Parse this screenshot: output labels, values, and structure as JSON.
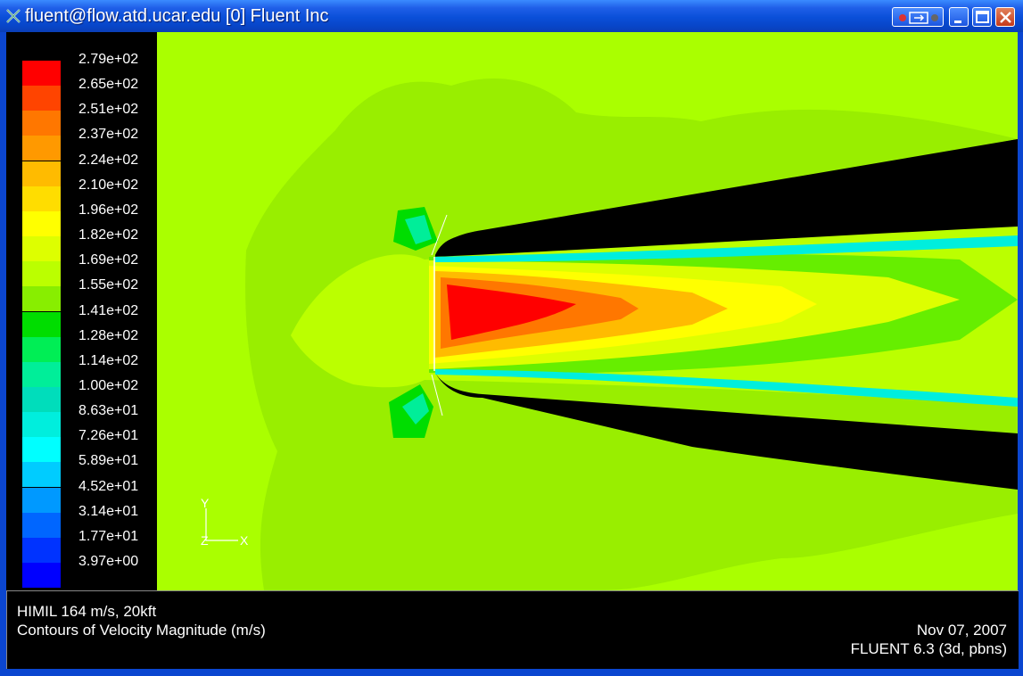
{
  "window": {
    "title": "fluent@flow.atd.ucar.edu [0] Fluent Inc",
    "icon": "x-icon",
    "buttons": [
      "extra-icon",
      "minimize-icon",
      "maximize-icon",
      "close-icon"
    ]
  },
  "legend": {
    "colors": [
      "#ff0000",
      "#ff4400",
      "#ff7700",
      "#ff9900",
      "#ffbb00",
      "#ffdd00",
      "#ffff00",
      "#ddff00",
      "#bbff00",
      "#88ee00",
      "#00dd00",
      "#00ee55",
      "#00ee99",
      "#00ddbb",
      "#00eedd",
      "#00ffff",
      "#00ccff",
      "#0099ff",
      "#0066ff",
      "#0033ff",
      "#0000ff"
    ],
    "labels": [
      "2.79e+02",
      "2.65e+02",
      "2.51e+02",
      "2.37e+02",
      "2.24e+02",
      "2.10e+02",
      "1.96e+02",
      "1.82e+02",
      "1.69e+02",
      "1.55e+02",
      "1.41e+02",
      "1.28e+02",
      "1.14e+02",
      "1.00e+02",
      "8.63e+01",
      "7.26e+01",
      "5.89e+01",
      "4.52e+01",
      "3.14e+01",
      "1.77e+01",
      "3.97e+00"
    ]
  },
  "axes": {
    "y": "Y",
    "z": "Z",
    "x": "X"
  },
  "info": {
    "case_title": "HIMIL 164 m/s, 20kft",
    "plot_title": "Contours of Velocity Magnitude (m/s)",
    "date": "Nov 07, 2007",
    "version": "FLUENT 6.3 (3d, pbns)"
  }
}
